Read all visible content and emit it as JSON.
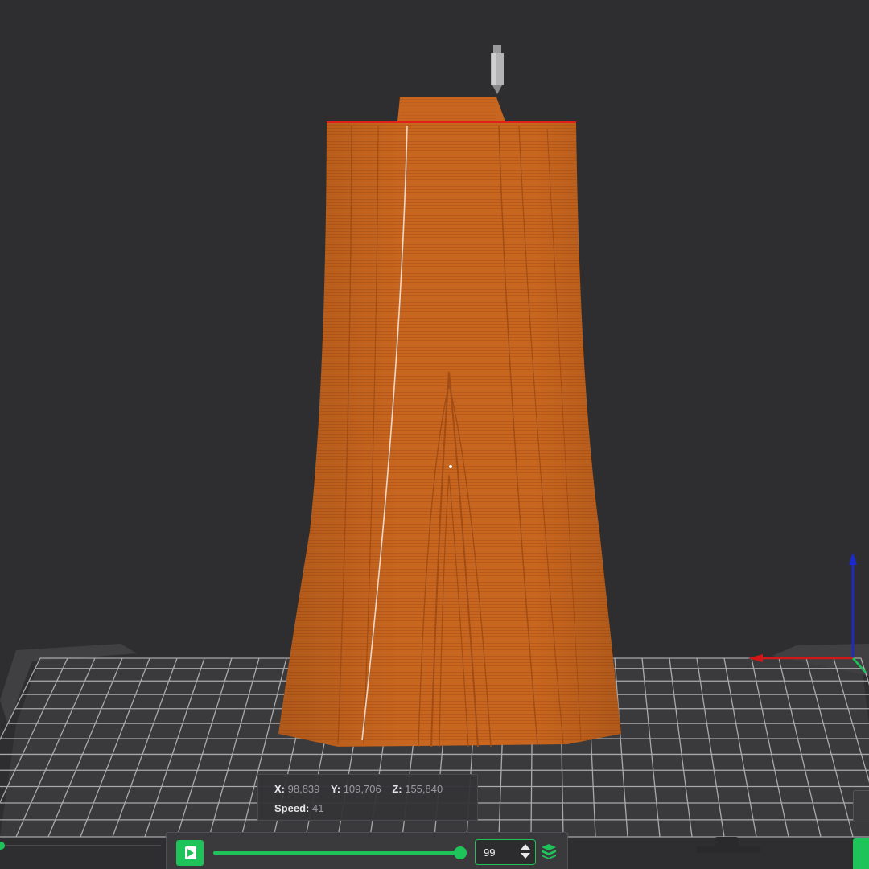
{
  "readout": {
    "x_label": "X:",
    "x_value": "98,839",
    "y_label": "Y:",
    "y_value": "109,706",
    "z_label": "Z:",
    "z_value": "155,840",
    "speed_label": "Speed:",
    "speed_value": "41"
  },
  "playback": {
    "layer_value": "99",
    "progress_fraction": 1.0
  },
  "colors": {
    "accent": "#1ec35a",
    "model": "#c8651e",
    "background": "#2e2e30",
    "axis_x": "#d01818",
    "axis_y": "#1ec35a",
    "axis_z": "#1a2acc"
  },
  "icons": {
    "play": "play-icon",
    "layers": "layers-icon",
    "nozzle": "nozzle-icon"
  }
}
